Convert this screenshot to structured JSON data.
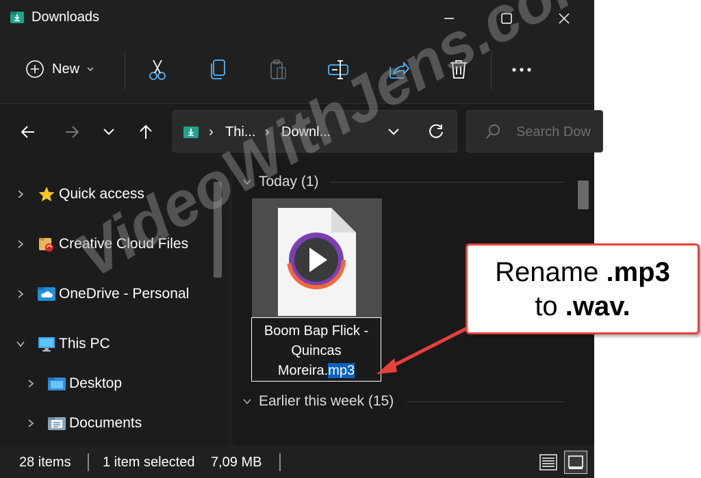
{
  "window": {
    "title": "Downloads"
  },
  "toolbar": {
    "new_label": "New",
    "icons": [
      "cut-icon",
      "copy-icon",
      "paste-icon",
      "rename-icon",
      "share-icon",
      "delete-icon",
      "more-icon"
    ]
  },
  "nav": {
    "crumb1": "Thi...",
    "crumb2": "Downl...",
    "search_placeholder": "Search Dow"
  },
  "sidebar": {
    "items": [
      {
        "label": "Quick access"
      },
      {
        "label": "Creative Cloud Files"
      },
      {
        "label": "OneDrive - Personal"
      },
      {
        "label": "This PC"
      },
      {
        "label": "Desktop"
      },
      {
        "label": "Documents"
      }
    ]
  },
  "main": {
    "group_today": "Today (1)",
    "group_earlier": "Earlier this week (15)",
    "file": {
      "line1": "Boom Bap Flick -",
      "line2": "Quincas",
      "line3_name": "Moreira.",
      "line3_ext": "mp3"
    }
  },
  "status": {
    "items": "28 items",
    "selected": "1 item selected",
    "size": "7,09 MB"
  },
  "callout": {
    "line1_a": "Rename ",
    "line1_b": ".mp3",
    "line2_a": "to ",
    "line2_b": ".wav."
  },
  "watermark": "VideoWithJens.com",
  "colors": {
    "accent": "#0a62c4",
    "callout_border": "#e8403c",
    "folder_green": "#1fa48a"
  }
}
